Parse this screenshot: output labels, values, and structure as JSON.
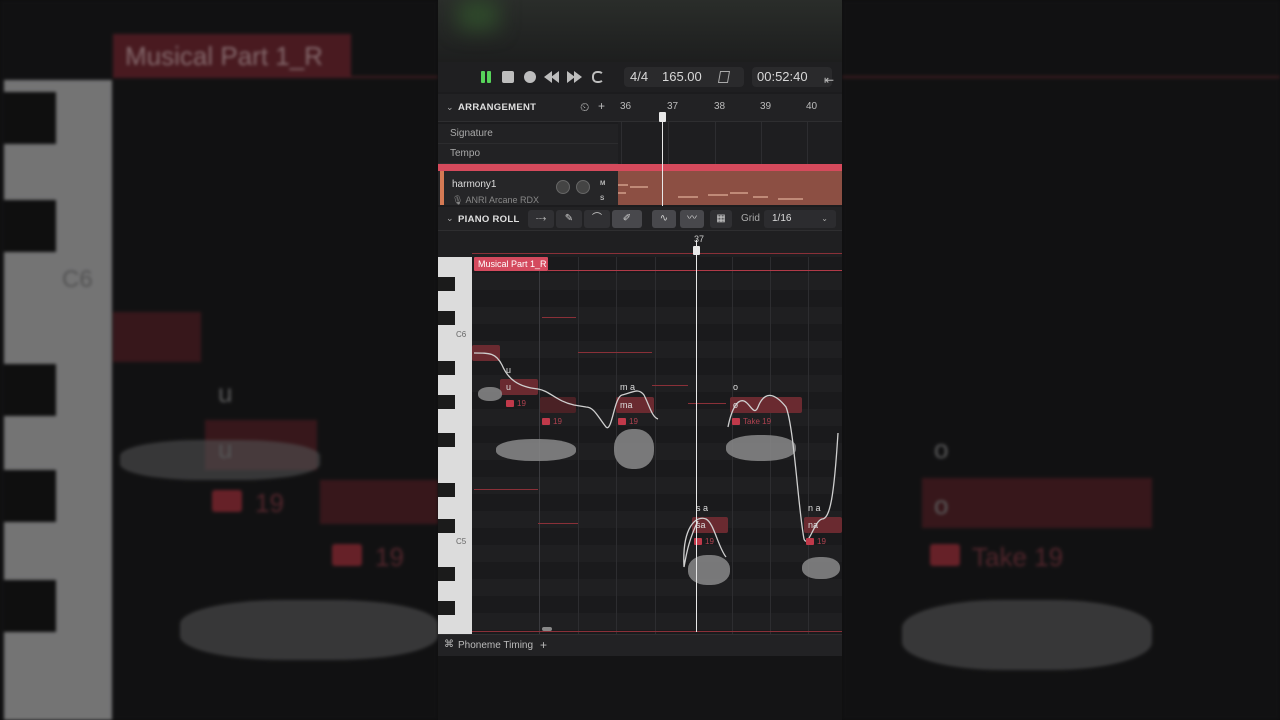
{
  "background": {
    "part_name": "Musical Part 1_R",
    "key_label": "C6",
    "lyric_u1": "u",
    "lyric_u2": "u",
    "take_a": "19",
    "take_b": "19",
    "lyric_o1": "o",
    "lyric_o2": "o",
    "take_c": "Take 19"
  },
  "transport": {
    "time_signature": "4/4",
    "tempo": "165.00",
    "position": "00:52:40"
  },
  "arrangement": {
    "title": "ARRANGEMENT",
    "ruler": [
      "36",
      "37",
      "38",
      "39",
      "40"
    ],
    "rows": [
      "Signature",
      "Tempo"
    ]
  },
  "track": {
    "name": "harmony1",
    "voice": "ANRI Arcane RDX",
    "mute": "M",
    "solo": "S",
    "color": "#d47a54"
  },
  "piano_roll": {
    "title": "PIANO ROLL",
    "grid_label": "Grid",
    "grid_value": "1/16",
    "marker": "37",
    "part_name": "Musical Part 1_R",
    "key_c6": "C6",
    "key_c5": "C5",
    "notes": [
      {
        "phoneme": "u",
        "lyric": "u",
        "take": "19"
      },
      {
        "phoneme": "",
        "lyric": "",
        "take": "19"
      },
      {
        "phoneme": "m a",
        "lyric": "ma",
        "take": "19"
      },
      {
        "phoneme": "o",
        "lyric": "o",
        "take": "Take 19"
      },
      {
        "phoneme": "s a",
        "lyric": "sa",
        "take": "19"
      },
      {
        "phoneme": "n a",
        "lyric": "na",
        "take": "19"
      }
    ]
  },
  "footer": {
    "label": "Phoneme Timing",
    "add": "+"
  },
  "colors": {
    "accent": "#d44a5e",
    "play": "#57d45a",
    "note": "#6a2a30"
  }
}
